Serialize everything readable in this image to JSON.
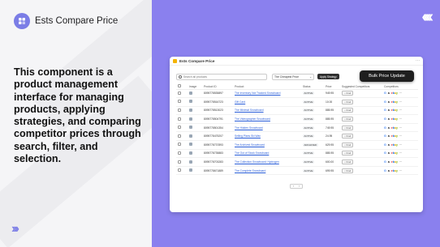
{
  "brand": {
    "name": "Ests Compare Price",
    "logo_icon": "logo-icon"
  },
  "headline": "This component is a product management interface for managing products, applying strategies, and comparing competitor prices through search, filter, and selection.",
  "decor": {
    "left_chevrons": "›››",
    "right_chevrons": "‹‹‹‹"
  },
  "colors": {
    "accent": "#8a80ee",
    "logo": "#7b7de6",
    "link": "#2b5fd9"
  },
  "app": {
    "title": "Ests Compare Price",
    "menu_dots": "···",
    "search_placeholder": "Search all products",
    "strategy_select": "The Cheapest Price",
    "apply_label": "Apply Strategy",
    "bulk_label": "Bulk Price Update",
    "columns": [
      "Image",
      "Product ID",
      "Product",
      "Status",
      "Price",
      "Suggested Competitors",
      "Competitors"
    ],
    "rows": [
      {
        "id": "8095778535897",
        "product": "The Inventory Not Tracked Snowboard",
        "status": "ACTIVE",
        "price": "949.95",
        "action": "Find"
      },
      {
        "id": "8095778516723",
        "product": "Gift Card",
        "status": "ACTIVE",
        "price": "10.00",
        "action": "Find"
      },
      {
        "id": "8095778513023",
        "product": "The Minimal Snowboard",
        "status": "ACTIVE",
        "price": "885.95",
        "action": "Find"
      },
      {
        "id": "8095778504791",
        "product": "The Videographer Snowboard",
        "status": "ACTIVE",
        "price": "885.95",
        "action": "Find"
      },
      {
        "id": "8095778501354",
        "product": "The Hidden Snowboard",
        "status": "ACTIVE",
        "price": "749.95",
        "action": "Find"
      },
      {
        "id": "8095778475207",
        "product": "Selling Plans Ski Wax",
        "status": "ACTIVE",
        "price": "24.95",
        "action": "Find"
      },
      {
        "id": "8095778737893",
        "product": "The Archived Snowboard",
        "status": "ARCHIVED",
        "price": "629.95",
        "action": "Find"
      },
      {
        "id": "8095778735883",
        "product": "The Out of Stock Snowboard",
        "status": "ACTIVE",
        "price": "885.95",
        "action": "Find"
      },
      {
        "id": "8095778703283",
        "product": "The Collection Snowboard: Hydrogen",
        "status": "ACTIVE",
        "price": "600.00",
        "action": "Find"
      },
      {
        "id": "8095778671889",
        "product": "The Complete Snowboard",
        "status": "ACTIVE",
        "price": "699.95",
        "action": "Find"
      }
    ],
    "pager": {
      "prev": "‹",
      "next": "›"
    }
  }
}
